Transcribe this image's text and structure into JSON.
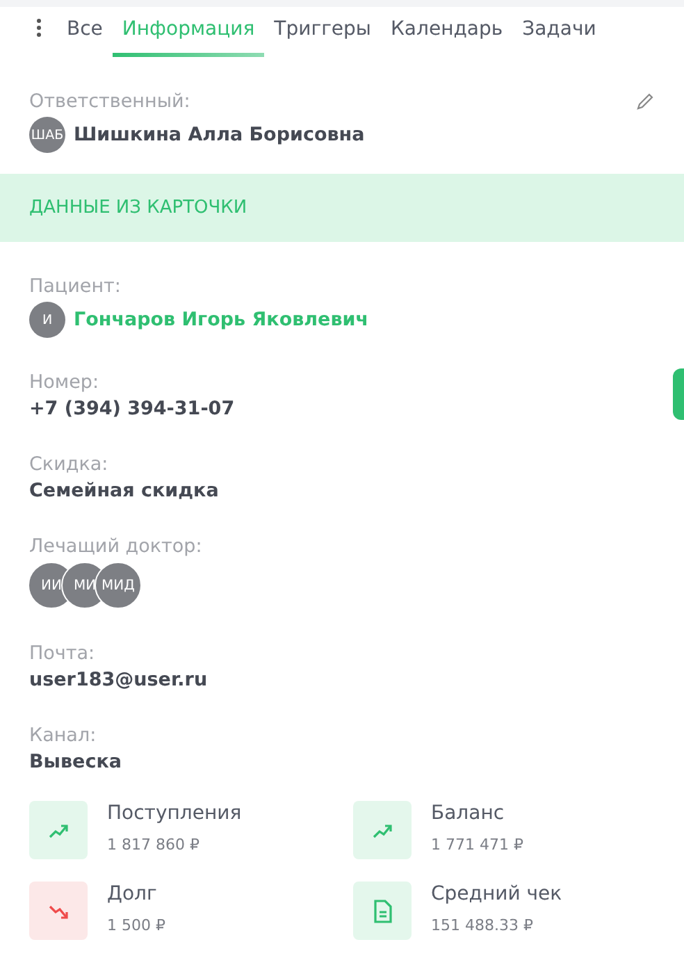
{
  "tabs": [
    {
      "label": "Все",
      "selected": false
    },
    {
      "label": "Информация",
      "selected": true
    },
    {
      "label": "Триггеры",
      "selected": false
    },
    {
      "label": "Календарь",
      "selected": false
    },
    {
      "label": "Задачи",
      "selected": false
    }
  ],
  "responsible": {
    "label": "Ответственный:",
    "avatar": "ШАБ",
    "name": "Шишкина Алла Борисовна"
  },
  "section_title": "ДАННЫЕ ИЗ КАРТОЧКИ",
  "fields": [
    {
      "kind": "person",
      "label": "Пациент:",
      "avatars": [
        "И"
      ],
      "value": "Гончаров Игорь Яковлевич"
    },
    {
      "kind": "text",
      "label": "Номер:",
      "value": "+7 (394) 394-31-07"
    },
    {
      "kind": "text",
      "label": "Скидка:",
      "value": "Семейная скидка"
    },
    {
      "kind": "avatars",
      "label": "Лечащий доктор:",
      "avatars": [
        "ИИ",
        "МИ",
        "МИД"
      ]
    },
    {
      "kind": "text",
      "label": "Почта:",
      "value": "user183@user.ru"
    },
    {
      "kind": "text",
      "label": "Канал:",
      "value": "Вывеска"
    }
  ],
  "stats": [
    {
      "kind": "up",
      "title": "Поступления",
      "value": "1 817 860 ₽"
    },
    {
      "kind": "up",
      "title": "Баланс",
      "value": "1 771 471 ₽"
    },
    {
      "kind": "down",
      "title": "Долг",
      "value": "1 500 ₽"
    },
    {
      "kind": "doc",
      "title": "Средний чек",
      "value": "151 488.33 ₽"
    }
  ]
}
